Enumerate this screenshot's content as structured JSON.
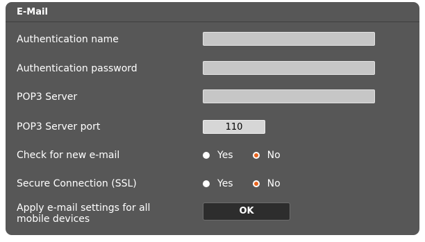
{
  "panel": {
    "title": "E-Mail"
  },
  "fields": {
    "auth_name": {
      "label": "Authentication name",
      "value": ""
    },
    "auth_password": {
      "label": "Authentication password",
      "value": ""
    },
    "pop3_server": {
      "label": "POP3 Server",
      "value": ""
    },
    "pop3_port": {
      "label": "POP3 Server port",
      "value": "110"
    }
  },
  "check_new_email": {
    "label": "Check for new e-mail",
    "options": [
      "Yes",
      "No"
    ],
    "selected": "No"
  },
  "secure_connection": {
    "label": "Secure Connection (SSL)",
    "options": [
      "Yes",
      "No"
    ],
    "selected": "No"
  },
  "apply": {
    "label_line1": "Apply e-mail settings for all",
    "label_line2": "mobile devices",
    "button_label": "OK"
  },
  "colors": {
    "panel_background": "#575757",
    "field_background": "#c6c6c6",
    "radio_selected_accent": "#e8641e",
    "button_background": "#2d2d2d"
  }
}
